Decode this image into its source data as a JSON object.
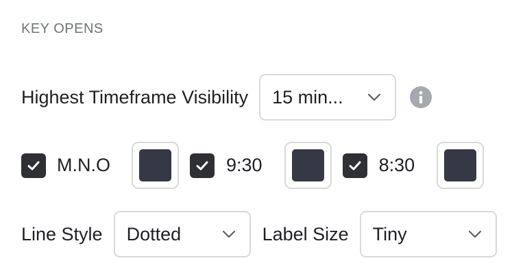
{
  "section": {
    "title": "KEY OPENS"
  },
  "timeframe": {
    "label": "Highest Timeframe Visibility",
    "value": "15 min...",
    "info_icon": "info-icon"
  },
  "opens": [
    {
      "label": "M.N.O",
      "checked": true,
      "color": "#363945"
    },
    {
      "label": "9:30",
      "checked": true,
      "color": "#363945"
    },
    {
      "label": "8:30",
      "checked": true,
      "color": "#363945"
    }
  ],
  "line_style": {
    "label": "Line Style",
    "value": "Dotted"
  },
  "label_size": {
    "label": "Label Size",
    "value": "Tiny"
  },
  "colors": {
    "checkbox": "#2f3034",
    "border": "#d7d9dc",
    "muted": "#6f7378",
    "info": "#a5a8ad"
  }
}
